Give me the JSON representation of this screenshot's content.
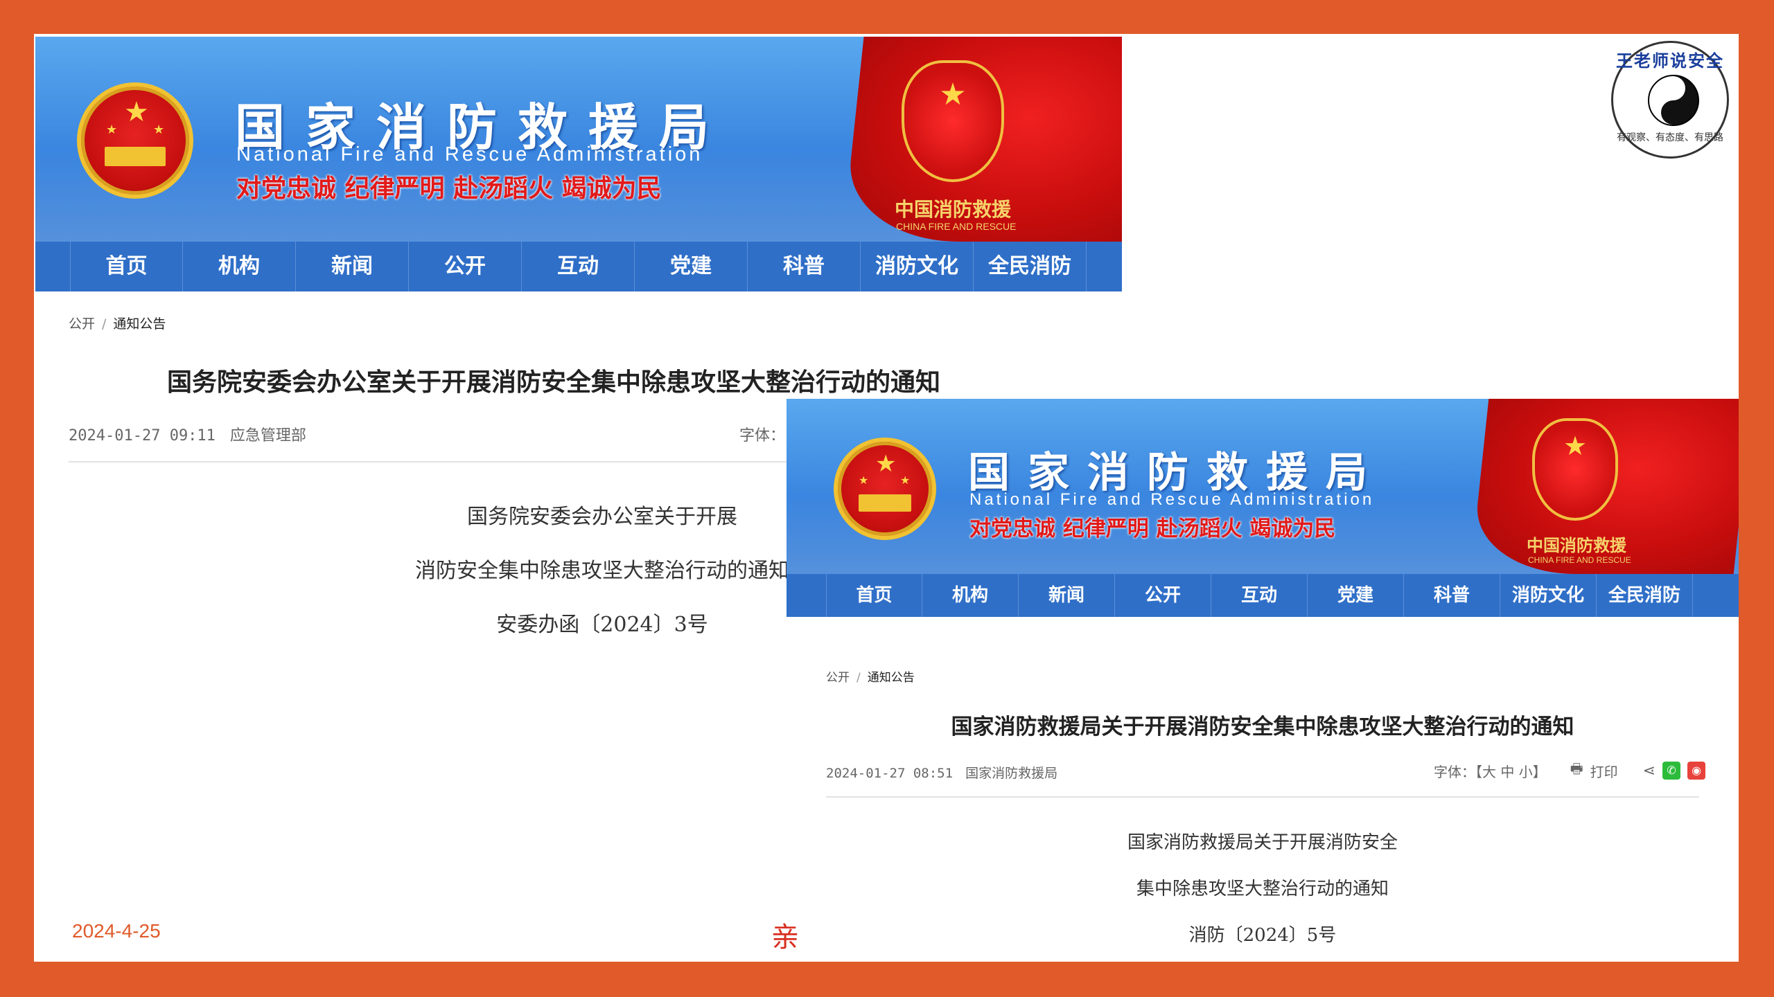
{
  "site": {
    "name_cn": "国家消防救援局",
    "name_en": "National Fire and Rescue Administration",
    "motto": "对党忠诚  纪律严明  赴汤蹈火  竭诚为民",
    "flag_text": "中国消防救援",
    "flag_sub": "CHINA FIRE AND RESCUE"
  },
  "nav": [
    "首页",
    "机构",
    "新闻",
    "公开",
    "互动",
    "党建",
    "科普",
    "消防文化",
    "全民消防"
  ],
  "page1": {
    "breadcrumb": [
      "公开",
      "通知公告"
    ],
    "title": "国务院安委会办公室关于开展消防安全集中除患攻坚大整治行动的通知",
    "date": "2024-01-27 09:11",
    "source": "应急管理部",
    "font_label": "字体：",
    "doc_lines": [
      "国务院安委会办公室关于开展",
      "消防安全集中除患攻坚大整治行动的通知",
      "安委办函〔2024〕3号"
    ]
  },
  "page2": {
    "breadcrumb": [
      "公开",
      "通知公告"
    ],
    "title": "国家消防救援局关于开展消防安全集中除患攻坚大整治行动的通知",
    "date": "2024-01-27 08:51",
    "source": "国家消防救援局",
    "font_size": "字体：【大 中 小】",
    "print": "打印",
    "doc_lines": [
      "国家消防救援局关于开展消防安全",
      "集中除患攻坚大整治行动的通知",
      "消防〔2024〕5号"
    ]
  },
  "slide": {
    "footer_date": "2024-4-25",
    "footer_char": "亲"
  },
  "seal": {
    "ring_text": "王老师说安全",
    "sub": "有观察、有态度、有思路"
  },
  "colors": {
    "frame": "#e05a2a",
    "nav": "#2f6fc8",
    "accent_red": "#e21a1a"
  }
}
